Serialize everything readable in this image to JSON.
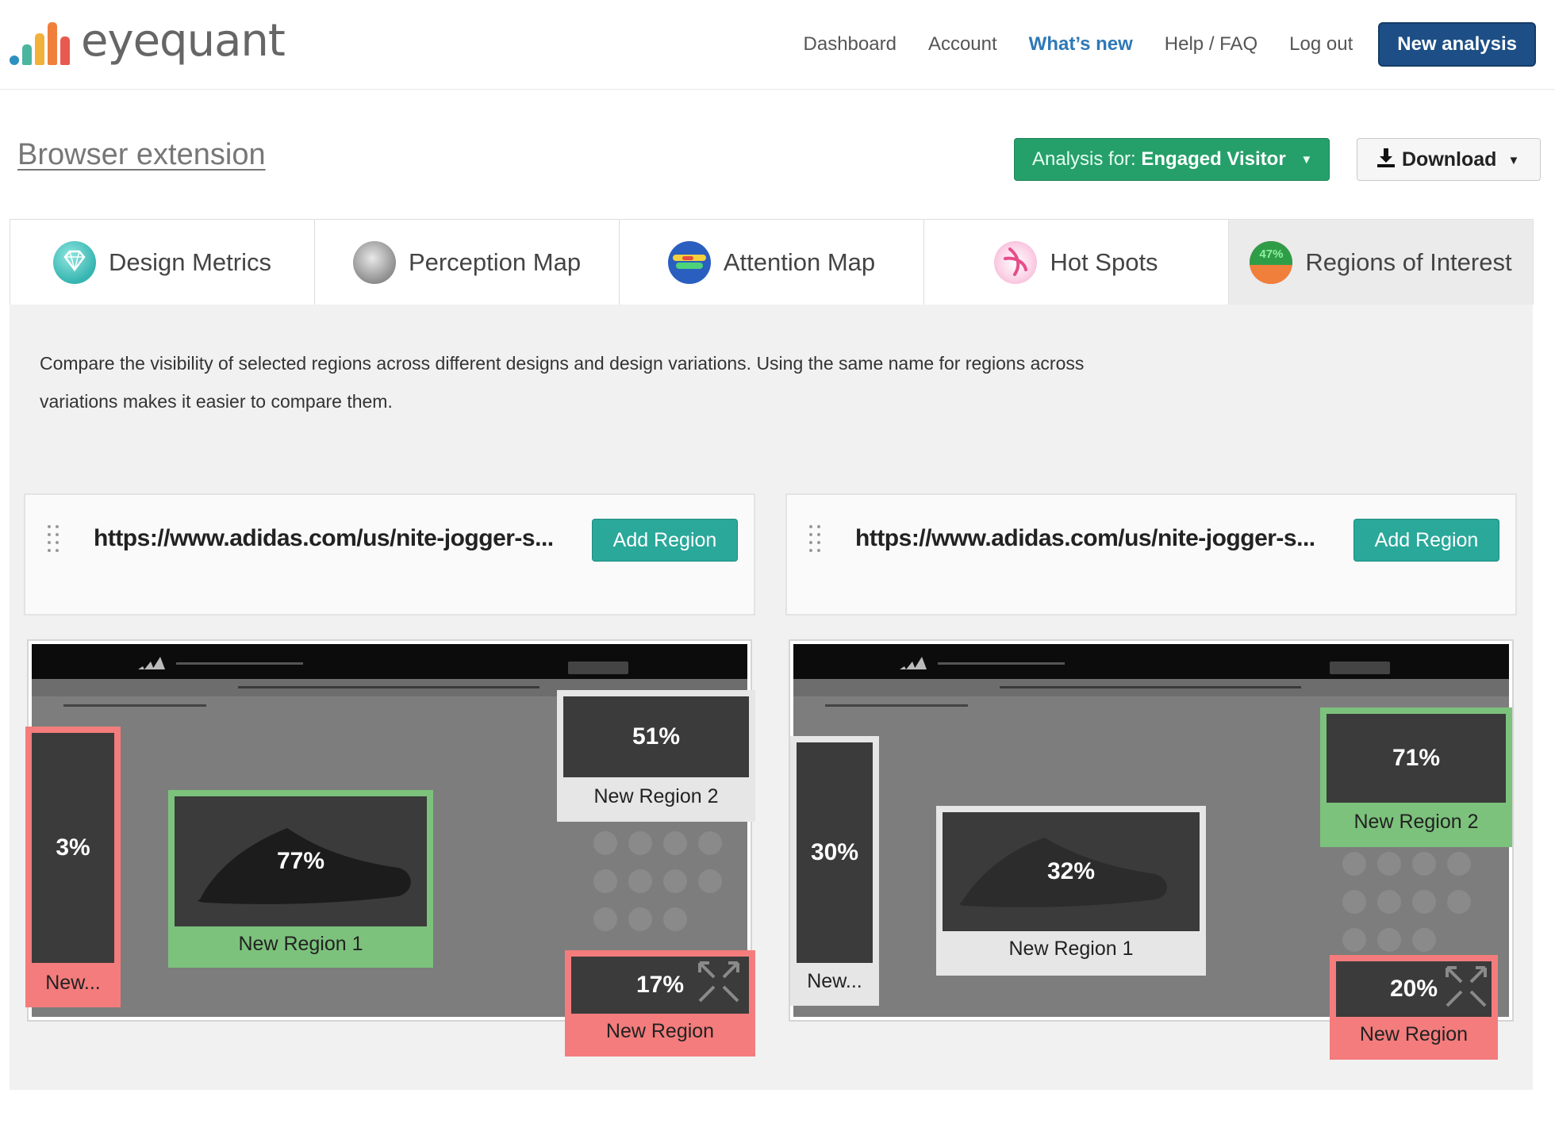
{
  "brand": {
    "name": "eyequant"
  },
  "nav": {
    "dashboard": "Dashboard",
    "account": "Account",
    "whats_new": "What’s new",
    "help": "Help / FAQ",
    "logout": "Log out",
    "new_analysis": "New analysis"
  },
  "page": {
    "title": "Browser extension",
    "analysis_prefix": "Analysis for:",
    "analysis_value": "Engaged Visitor",
    "download": "Download"
  },
  "tabs": [
    {
      "label": "Design Metrics",
      "icon": "diamond-icon"
    },
    {
      "label": "Perception Map",
      "icon": "perception-map-icon"
    },
    {
      "label": "Attention Map",
      "icon": "attention-map-icon"
    },
    {
      "label": "Hot Spots",
      "icon": "hot-spots-icon"
    },
    {
      "label": "Regions of Interest",
      "icon": "regions-of-interest-icon",
      "badge": "47%"
    }
  ],
  "active_tab": "Regions of Interest",
  "description": "Compare the visibility of selected regions across different designs and design variations. Using the same name for regions across variations makes it easier to compare them.",
  "designs": [
    {
      "url": "https://www.adidas.com/us/nite-jogger-s...",
      "add_region": "Add Region",
      "regions": [
        {
          "value": "3%",
          "label": "New...",
          "color": "red"
        },
        {
          "value": "77%",
          "label": "New Region 1",
          "color": "green"
        },
        {
          "value": "51%",
          "label": "New Region 2",
          "color": "grey"
        },
        {
          "value": "17%",
          "label": "New Region",
          "color": "red"
        }
      ]
    },
    {
      "url": "https://www.adidas.com/us/nite-jogger-s...",
      "add_region": "Add Region",
      "regions": [
        {
          "value": "30%",
          "label": "New...",
          "color": "grey"
        },
        {
          "value": "32%",
          "label": "New Region 1",
          "color": "grey"
        },
        {
          "value": "71%",
          "label": "New Region 2",
          "color": "green"
        },
        {
          "value": "20%",
          "label": "New Region",
          "color": "red"
        }
      ]
    }
  ],
  "colors": {
    "red": "#f47c7c",
    "green": "#7cc27c",
    "grey": "#e6e6e6",
    "primary": "#1d4f86",
    "teal": "#2aa89a",
    "analysis_green": "#26a06a"
  }
}
